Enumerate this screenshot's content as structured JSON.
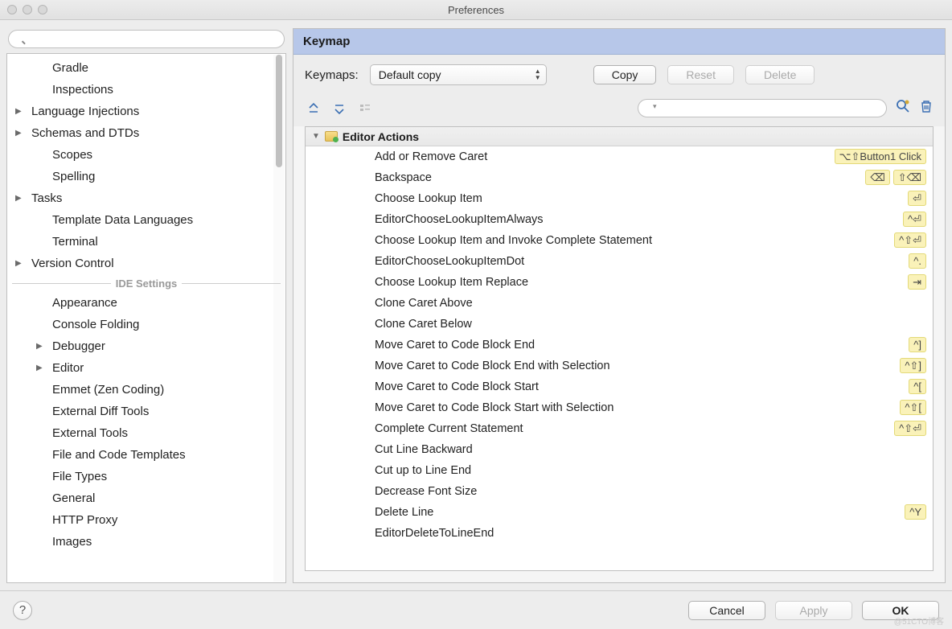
{
  "window": {
    "title": "Preferences"
  },
  "left": {
    "items": [
      {
        "label": "Gradle",
        "indent": true,
        "arrow": false
      },
      {
        "label": "Inspections",
        "indent": true,
        "arrow": false
      },
      {
        "label": "Language Injections",
        "indent": false,
        "arrow": true
      },
      {
        "label": "Schemas and DTDs",
        "indent": false,
        "arrow": true
      },
      {
        "label": "Scopes",
        "indent": true,
        "arrow": false
      },
      {
        "label": "Spelling",
        "indent": true,
        "arrow": false
      },
      {
        "label": "Tasks",
        "indent": false,
        "arrow": true
      },
      {
        "label": "Template Data Languages",
        "indent": true,
        "arrow": false
      },
      {
        "label": "Terminal",
        "indent": true,
        "arrow": false
      },
      {
        "label": "Version Control",
        "indent": false,
        "arrow": true
      }
    ],
    "sep": "IDE Settings",
    "items2": [
      {
        "label": "Appearance",
        "arrow": false
      },
      {
        "label": "Console Folding",
        "arrow": false
      },
      {
        "label": "Debugger",
        "arrow": true
      },
      {
        "label": "Editor",
        "arrow": true
      },
      {
        "label": "Emmet (Zen Coding)",
        "arrow": false
      },
      {
        "label": "External Diff Tools",
        "arrow": false
      },
      {
        "label": "External Tools",
        "arrow": false
      },
      {
        "label": "File and Code Templates",
        "arrow": false
      },
      {
        "label": "File Types",
        "arrow": false
      },
      {
        "label": "General",
        "arrow": false
      },
      {
        "label": "HTTP Proxy",
        "arrow": false
      },
      {
        "label": "Images",
        "arrow": false
      }
    ]
  },
  "right": {
    "title": "Keymap",
    "keymaps_label": "Keymaps:",
    "keymaps_value": "Default copy",
    "copy": "Copy",
    "reset": "Reset",
    "delete": "Delete",
    "category": "Editor Actions",
    "actions": [
      {
        "label": "Add or Remove Caret",
        "shortcuts": [
          "⌥⇧Button1 Click"
        ]
      },
      {
        "label": "Backspace",
        "shortcuts": [
          "⌫",
          "⇧⌫"
        ]
      },
      {
        "label": "Choose Lookup Item",
        "shortcuts": [
          "⏎"
        ]
      },
      {
        "label": "EditorChooseLookupItemAlways",
        "shortcuts": [
          "^⏎"
        ]
      },
      {
        "label": "Choose Lookup Item and Invoke Complete Statement",
        "shortcuts": [
          "^⇧⏎"
        ]
      },
      {
        "label": "EditorChooseLookupItemDot",
        "shortcuts": [
          "^."
        ]
      },
      {
        "label": "Choose Lookup Item Replace",
        "shortcuts": [
          "⇥"
        ]
      },
      {
        "label": "Clone Caret Above",
        "shortcuts": []
      },
      {
        "label": "Clone Caret Below",
        "shortcuts": []
      },
      {
        "label": "Move Caret to Code Block End",
        "shortcuts": [
          "^]"
        ]
      },
      {
        "label": "Move Caret to Code Block End with Selection",
        "shortcuts": [
          "^⇧]"
        ]
      },
      {
        "label": "Move Caret to Code Block Start",
        "shortcuts": [
          "^["
        ]
      },
      {
        "label": "Move Caret to Code Block Start with Selection",
        "shortcuts": [
          "^⇧["
        ]
      },
      {
        "label": "Complete Current Statement",
        "shortcuts": [
          "^⇧⏎"
        ]
      },
      {
        "label": "Cut Line Backward",
        "shortcuts": []
      },
      {
        "label": "Cut up to Line End",
        "shortcuts": []
      },
      {
        "label": "Decrease Font Size",
        "shortcuts": []
      },
      {
        "label": "Delete Line",
        "shortcuts": [
          "^Y"
        ]
      },
      {
        "label": "EditorDeleteToLineEnd",
        "shortcuts": []
      }
    ]
  },
  "footer": {
    "cancel": "Cancel",
    "apply": "Apply",
    "ok": "OK"
  },
  "watermark": "@51CTO博客"
}
